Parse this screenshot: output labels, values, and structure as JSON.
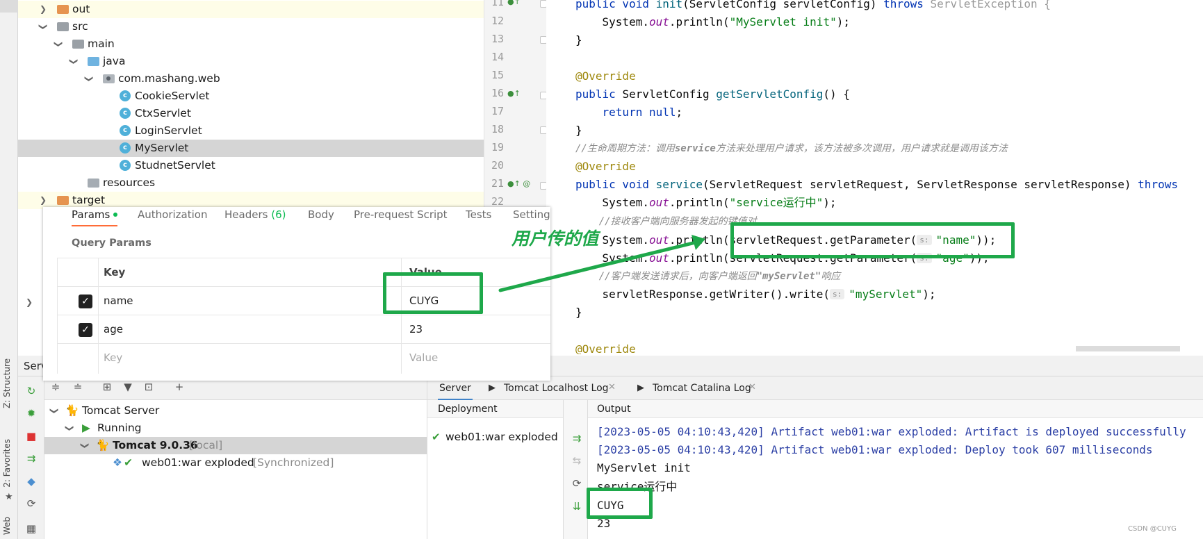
{
  "project_tree": {
    "items": [
      {
        "label": "out",
        "icon": "folder-orange-icon",
        "expanded": false
      },
      {
        "label": "src",
        "icon": "folder-gray-icon",
        "expanded": true
      },
      {
        "label": "main",
        "icon": "folder-gray-icon",
        "expanded": true
      },
      {
        "label": "java",
        "icon": "folder-blue-icon",
        "expanded": true
      },
      {
        "label": "com.mashang.web",
        "icon": "package-icon",
        "expanded": true
      },
      {
        "label": "CookieServlet",
        "icon": "class-icon"
      },
      {
        "label": "CtxServlet",
        "icon": "class-icon"
      },
      {
        "label": "LoginServlet",
        "icon": "class-icon"
      },
      {
        "label": "MyServlet",
        "icon": "class-icon",
        "selected": true
      },
      {
        "label": "StudnetServlet",
        "icon": "class-icon"
      },
      {
        "label": "resources",
        "icon": "folder-resources-icon"
      },
      {
        "label": "target",
        "icon": "folder-orange-icon",
        "expanded": false
      }
    ],
    "class_glyph": "c"
  },
  "editor": {
    "line_numbers": [
      "11",
      "12",
      "13",
      "14",
      "15",
      "16",
      "17",
      "18",
      "19",
      "20",
      "21",
      "22"
    ],
    "line_11": {
      "kw1": "public void ",
      "fn": "init",
      "rest": "(ServletConfig servletConfig) ",
      "kw2": "throws ",
      "gy": "ServletException {"
    },
    "line_12": {
      "pre": "    System.",
      "it": "out",
      "mid": ".println(",
      "st": "\"MyServlet init\"",
      "post": ");"
    },
    "line_13": "}",
    "line_15": "@Override",
    "line_16": {
      "kw": "public ",
      "type": "ServletConfig ",
      "fn": "getServletConfig",
      "post": "() {"
    },
    "line_17": {
      "kw": "    return null",
      "post": ";"
    },
    "line_18": "}",
    "line_19": {
      "pre": "//生命周期方法：调用",
      "b": "service",
      "post": "方法来处理用户请求，该方法被多次调用，用户请求就是调用该方法"
    },
    "line_20": "@Override",
    "line_21": {
      "kw": "public void ",
      "fn": "service",
      "rest": "(ServletRequest servletRequest, ServletResponse servletResponse) ",
      "kw2": "throws"
    },
    "line_22": {
      "pre": "    System.",
      "it": "out",
      "mid": ".println(",
      "st": "\"service运行中\"",
      "post": ");"
    },
    "line_23": "    //接收客户端向服务器发起的键值对",
    "line_24": {
      "pre": "    System.",
      "it": "out",
      "mid": ".println(servletRequest.getParameter(",
      "hint": "s:",
      "st": "\"name\"",
      "post": "));"
    },
    "line_25": {
      "pre": "    System.",
      "it": "out",
      "mid": ".println(servletRequest.getParameter(",
      "hint": "s:",
      "st": "\"age\"",
      "post": "));"
    },
    "line_26": {
      "pre": "    //客户端发送请求后，向客户端返回",
      "b": "\"myServlet\"",
      "post": "响应"
    },
    "line_27": {
      "pre": "    servletResponse.getWriter().write(",
      "hint": "s:",
      "st": "\"myServlet\"",
      "post": ");"
    },
    "line_28": "}",
    "line_30": "@Override"
  },
  "annotation": {
    "text": "用户传的值",
    "color": "#1ea84a"
  },
  "postman": {
    "tabs": [
      {
        "label": "Params",
        "active": true
      },
      {
        "label": "Authorization"
      },
      {
        "label": "Headers",
        "count": "(6)"
      },
      {
        "label": "Body"
      },
      {
        "label": "Pre-request Script"
      },
      {
        "label": "Tests"
      },
      {
        "label": "Settings"
      }
    ],
    "query_params_title": "Query Params",
    "columns": {
      "key": "Key",
      "value": "Value"
    },
    "rows": [
      {
        "checked": true,
        "key": "name",
        "value": "CUYG"
      },
      {
        "checked": true,
        "key": "age",
        "value": "23"
      }
    ],
    "placeholder": {
      "key": "Key",
      "value": "Value"
    },
    "check_glyph": "✓"
  },
  "services": {
    "header_title": "Serv",
    "tree": {
      "server": "Tomcat Server",
      "status": "Running",
      "instance": "Tomcat 9.0.36",
      "instance_tag": "[local]",
      "artifact": "web01:war exploded",
      "artifact_tag": "[Synchronized]"
    },
    "tabs": [
      {
        "label": "Server",
        "active": true
      },
      {
        "label": "Tomcat Localhost Log"
      },
      {
        "label": "Tomcat Catalina Log"
      }
    ],
    "deployment_header": "Deployment",
    "deployment_item": "web01:war exploded",
    "output_header": "Output",
    "output_lines": [
      "[2023-05-05 04:10:43,420] Artifact web01:war exploded: Artifact is deployed successfully",
      "[2023-05-05 04:10:43,420] Artifact web01:war exploded: Deploy took 607 milliseconds",
      "MyServlet init",
      "service运行中",
      "CUYG",
      "23"
    ]
  },
  "side_tabs": {
    "structure": "Z: Structure",
    "favorites": "2: Favorites",
    "web": "Web"
  },
  "watermark": "CSDN @CUYG"
}
